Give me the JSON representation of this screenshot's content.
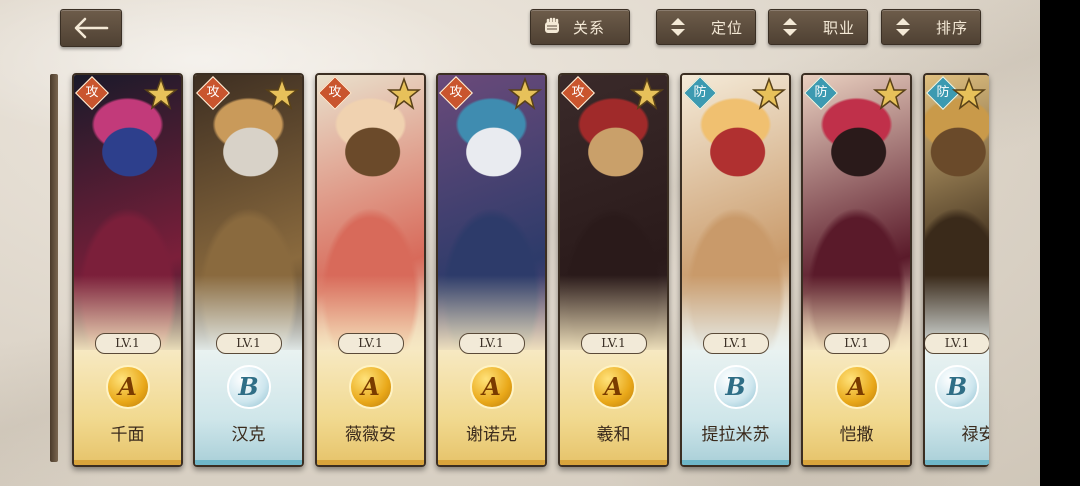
{
  "toolbar": {
    "relation_label": "关系",
    "position_label": "定位",
    "class_label": "职业",
    "sort_label": "排序"
  },
  "colors": {
    "attack_badge": "#c9552e",
    "defense_badge": "#3c9ab1",
    "gold_card": "#f1d98f",
    "blue_card": "#cfe6ea",
    "button": "#5c4c3c"
  },
  "heroes": [
    {
      "role": "攻",
      "level": "LV.1",
      "grade": "A",
      "name": "千面",
      "theme": "gold",
      "palette": [
        "#7b1f3a",
        "#c23a7a",
        "#2d3f8c",
        "#1a1a2a"
      ]
    },
    {
      "role": "攻",
      "level": "LV.1",
      "grade": "B",
      "name": "汉克",
      "theme": "blue",
      "palette": [
        "#8a6a3e",
        "#c99a5a",
        "#d8d2c8",
        "#3e2f22"
      ]
    },
    {
      "role": "攻",
      "level": "LV.1",
      "grade": "A",
      "name": "薇薇安",
      "theme": "gold",
      "palette": [
        "#d86a5a",
        "#f0d2b0",
        "#6b4a2a",
        "#e9e0cc"
      ]
    },
    {
      "role": "攻",
      "level": "LV.1",
      "grade": "A",
      "name": "谢诺克",
      "theme": "gold",
      "palette": [
        "#2d3b6a",
        "#3f8cb0",
        "#e9ebf0",
        "#6a4a7a"
      ]
    },
    {
      "role": "攻",
      "level": "LV.1",
      "grade": "A",
      "name": "羲和",
      "theme": "gold",
      "palette": [
        "#2a1a1a",
        "#a02a2a",
        "#c9a06a",
        "#3a2a2a"
      ]
    },
    {
      "role": "防",
      "level": "LV.1",
      "grade": "B",
      "name": "提拉米苏",
      "theme": "blue",
      "palette": [
        "#c99a6a",
        "#f0c070",
        "#b03030",
        "#f4ead8"
      ]
    },
    {
      "role": "防",
      "level": "LV.1",
      "grade": "A",
      "name": "恺撒",
      "theme": "gold",
      "palette": [
        "#5a1a2a",
        "#c0304a",
        "#2a1a1a",
        "#e9d0c0"
      ]
    },
    {
      "role": "防",
      "level": "LV.1",
      "grade": "B",
      "name": "禄安",
      "theme": "blue",
      "palette": [
        "#3a2a1a",
        "#c99a4a",
        "#6a4a2a",
        "#e0c080"
      ]
    }
  ]
}
